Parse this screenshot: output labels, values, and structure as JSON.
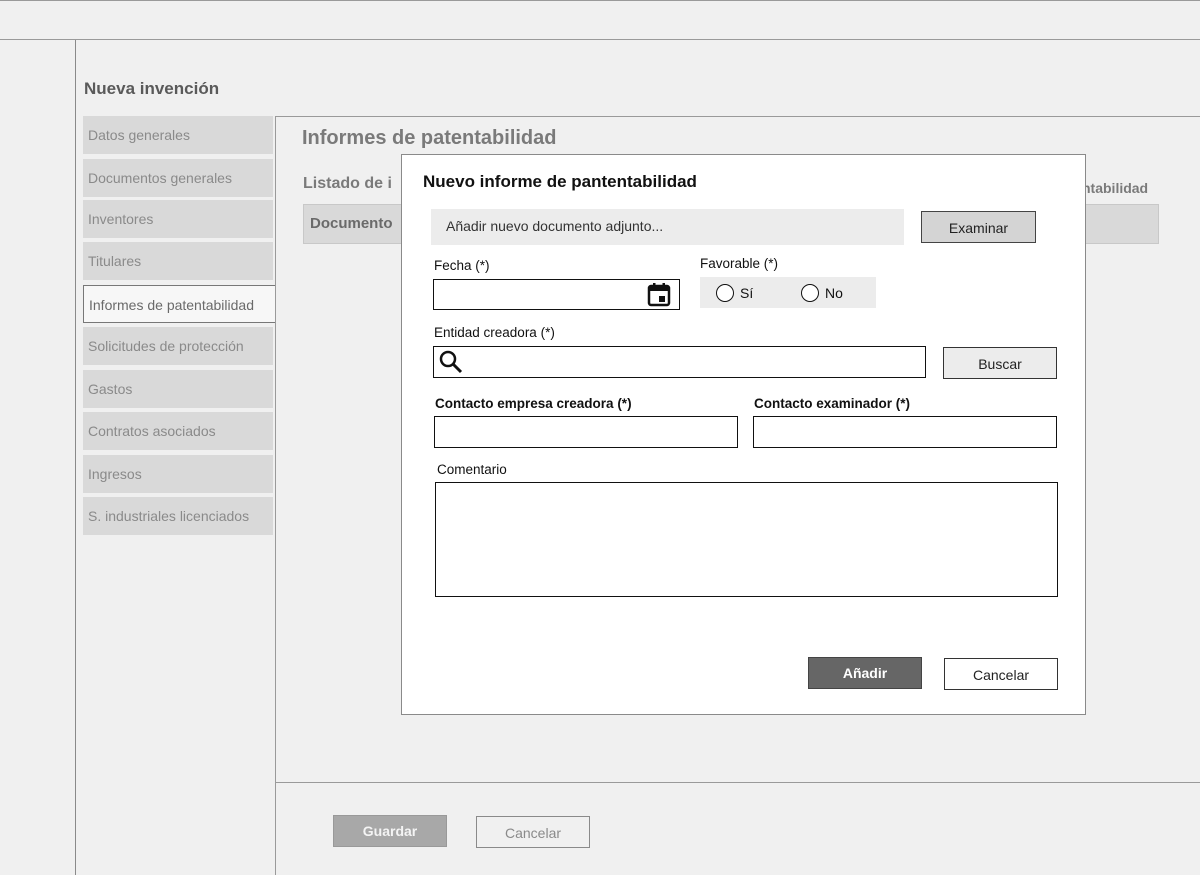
{
  "page": {
    "title": "Nueva invención"
  },
  "sidebar": {
    "items": [
      {
        "label": "Datos generales"
      },
      {
        "label": "Documentos generales"
      },
      {
        "label": "Inventores"
      },
      {
        "label": "Titulares"
      },
      {
        "label": "Informes de patentabilidad",
        "active": true
      },
      {
        "label": "Solicitudes de protección"
      },
      {
        "label": "Gastos"
      },
      {
        "label": "Contratos asociados"
      },
      {
        "label": "Ingresos"
      },
      {
        "label": "S. industriales licenciados"
      }
    ]
  },
  "main": {
    "section_title": "Informes de patentabilidad",
    "list_title": "Listado de i",
    "list_title_right": "ntabilidad",
    "table_header": "Documento"
  },
  "footer": {
    "save_label": "Guardar",
    "cancel_label": "Cancelar"
  },
  "modal": {
    "title": "Nuevo informe de pantentabilidad",
    "attach_placeholder": "Añadir nuevo documento adjunto...",
    "browse_label": "Examinar",
    "date_label": "Fecha (*)",
    "date_icon": "calendar-icon",
    "favorable_label": "Favorable (*)",
    "favorable_options": [
      "Sí",
      "No"
    ],
    "entity_label": "Entidad creadora (*)",
    "entity_icon": "search-icon",
    "search_label": "Buscar",
    "contact_company_label": "Contacto empresa creadora (*)",
    "contact_examiner_label": "Contacto examinador (*)",
    "comment_label": "Comentario",
    "add_label": "Añadir",
    "cancel_label": "Cancelar"
  }
}
